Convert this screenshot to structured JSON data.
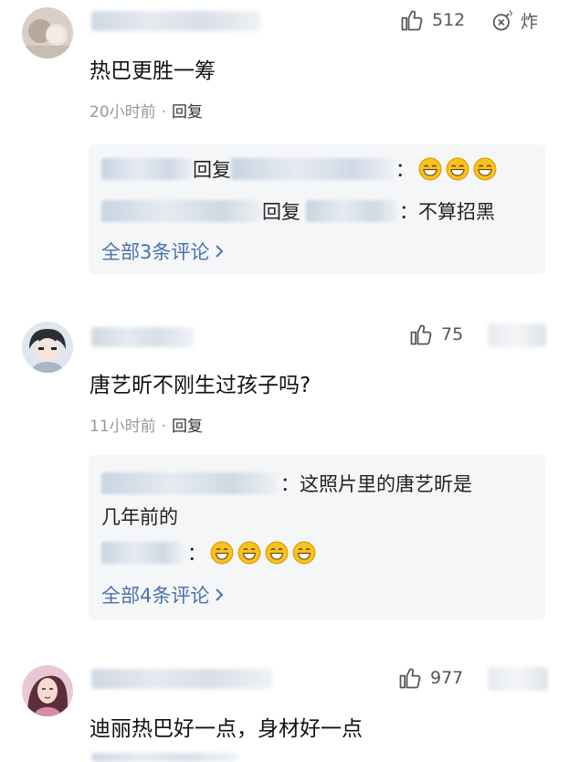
{
  "comments": [
    {
      "likes": "512",
      "bomb_label": "炸",
      "text": "热巴更胜一筹",
      "time": "20小时前",
      "reply_label": "回复",
      "replies": [
        {
          "verb": "回复",
          "sep": "：",
          "content": ""
        },
        {
          "verb": "回复",
          "sep": "：",
          "content": "不算招黑"
        }
      ],
      "view_all": "全部3条评论"
    },
    {
      "likes": "75",
      "text": "唐艺昕不刚生过孩子吗?",
      "time": "11小时前",
      "reply_label": "回复",
      "replies": [
        {
          "sep": "：",
          "content": "这照片里的唐艺昕是"
        },
        {
          "content": "几年前的"
        },
        {
          "sep": "：",
          "content": ""
        }
      ],
      "view_all": "全部4条评论"
    },
    {
      "likes": "977",
      "text": "迪丽热巴好一点，身材好一点"
    }
  ],
  "icons": {
    "like": "thumbs-up-icon",
    "bomb": "bomb-icon",
    "chevron": "chevron-right-icon",
    "emoji_grin": "grinning-emoji-icon",
    "emoji_laugh": "laughing-emoji-icon"
  },
  "colors": {
    "link": "#4a72a8",
    "meta": "#999999",
    "reply_bg": "#f5f6f8",
    "emoji_yellow": "#f7c21b"
  }
}
